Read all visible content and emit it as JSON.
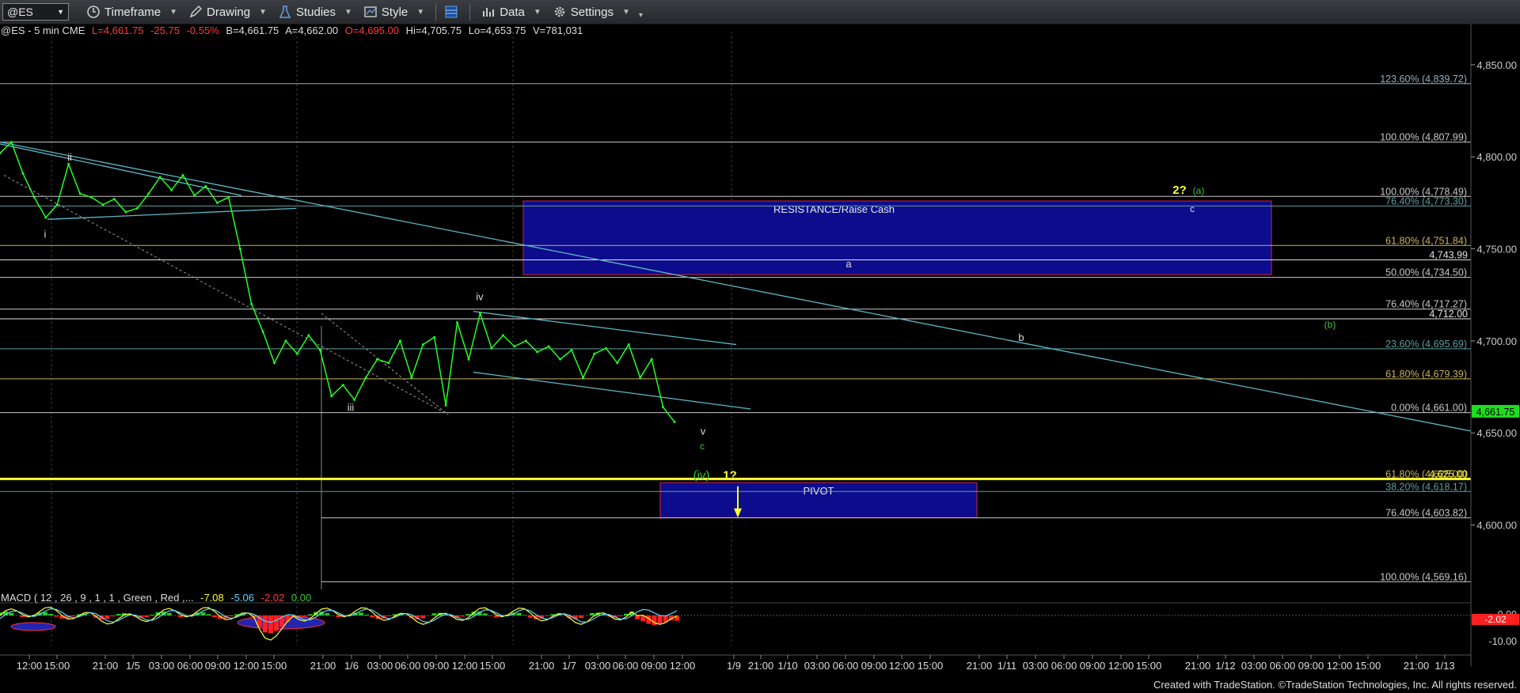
{
  "toolbar": {
    "symbol": "@ES",
    "items": [
      {
        "label": "Timeframe",
        "icon": "clock-icon"
      },
      {
        "label": "Drawing",
        "icon": "pen-icon"
      },
      {
        "label": "Studies",
        "icon": "flask-icon"
      },
      {
        "label": "Style",
        "icon": "chart-style-icon"
      },
      {
        "label": "",
        "icon": "layout-icon"
      },
      {
        "label": "Data",
        "icon": "bar-chart-icon"
      },
      {
        "label": "Settings",
        "icon": "gear-icon"
      }
    ]
  },
  "status": {
    "symbol": "@ES - 5 min  CME",
    "last": "L=4,661.75",
    "change": "-25.75",
    "pct": "-0.55%",
    "bid": "B=4,661.75",
    "ask": "A=4,662.00",
    "open": "O=4,695.00",
    "hi": "Hi=4,705.75",
    "lo": "Lo=4,653.75",
    "vol": "V=781,031"
  },
  "macd": {
    "label": "MACD ( 12 , 26 , 9 , 1 , 1 , Green , Red ,...",
    "v1": "-7.08",
    "v2": "-5.06",
    "v3": "-2.02",
    "v4": "0.00",
    "axis": [
      "0.00",
      "-10.00"
    ],
    "current": "-2.02"
  },
  "chart_data": {
    "type": "line",
    "title": "@ES - 5 min",
    "y_ticks": [
      4850,
      4800,
      4750,
      4700,
      4650,
      4600
    ],
    "y_tick_labels": [
      "4,850.00",
      "4,800.00",
      "4,750.00",
      "4,700.00",
      "4,650.00",
      "4,600.00"
    ],
    "ylim": [
      4565,
      4868
    ],
    "last_price_label": "4,661.75",
    "x_tick_labels": [
      "12:00",
      "15:00",
      "21:00",
      "1/5",
      "03:00",
      "06:00",
      "09:00",
      "12:00",
      "15:00",
      "21:00",
      "1/6",
      "03:00",
      "06:00",
      "09:00",
      "12:00",
      "15:00",
      "21:00",
      "1/7",
      "03:00",
      "06:00",
      "09:00",
      "12:00",
      "1/9",
      "21:00",
      "1/10",
      "03:00",
      "06:00",
      "09:00",
      "12:00",
      "15:00",
      "21:00",
      "1/11",
      "03:00",
      "06:00",
      "09:00",
      "12:00",
      "15:00",
      "21:00",
      "1/12",
      "03:00",
      "06:00",
      "09:00",
      "12:00",
      "15:00",
      "21:00",
      "1/13"
    ],
    "price_series": [
      [
        0,
        4802
      ],
      [
        1,
        4808
      ],
      [
        2,
        4791
      ],
      [
        3,
        4778
      ],
      [
        4,
        4767
      ],
      [
        5,
        4774
      ],
      [
        6,
        4796
      ],
      [
        7,
        4780
      ],
      [
        8,
        4778
      ],
      [
        9,
        4774
      ],
      [
        10,
        4777
      ],
      [
        11,
        4770
      ],
      [
        12,
        4772
      ],
      [
        13,
        4780
      ],
      [
        14,
        4789
      ],
      [
        15,
        4782
      ],
      [
        16,
        4790
      ],
      [
        17,
        4779
      ],
      [
        18,
        4784
      ],
      [
        19,
        4775
      ],
      [
        20,
        4778
      ],
      [
        21,
        4750
      ],
      [
        22,
        4720
      ],
      [
        23,
        4705
      ],
      [
        24,
        4688
      ],
      [
        25,
        4700
      ],
      [
        26,
        4693
      ],
      [
        27,
        4703
      ],
      [
        28,
        4695
      ],
      [
        29,
        4670
      ],
      [
        30,
        4676
      ],
      [
        31,
        4668
      ],
      [
        32,
        4680
      ],
      [
        33,
        4690
      ],
      [
        34,
        4688
      ],
      [
        35,
        4700
      ],
      [
        36,
        4680
      ],
      [
        37,
        4698
      ],
      [
        38,
        4702
      ],
      [
        39,
        4665
      ],
      [
        40,
        4710
      ],
      [
        41,
        4690
      ],
      [
        42,
        4715
      ],
      [
        43,
        4696
      ],
      [
        44,
        4703
      ],
      [
        45,
        4697
      ],
      [
        46,
        4700
      ],
      [
        47,
        4694
      ],
      [
        48,
        4697
      ],
      [
        49,
        4690
      ],
      [
        50,
        4695
      ],
      [
        51,
        4680
      ],
      [
        52,
        4693
      ],
      [
        53,
        4696
      ],
      [
        54,
        4688
      ],
      [
        55,
        4698
      ],
      [
        56,
        4680
      ],
      [
        57,
        4690
      ],
      [
        58,
        4664
      ],
      [
        59,
        4656
      ]
    ],
    "levels": [
      {
        "label": "123.60% (4,839.72)",
        "value": 4839.72,
        "color": "#9aaec0"
      },
      {
        "label": "100.00% (4,807.99)",
        "value": 4807.99,
        "color": "#c8c8c8"
      },
      {
        "label": "100.00% (4,778.49)",
        "value": 4778.49,
        "color": "#c8c8c8"
      },
      {
        "label": "76.40% (4,773.30)",
        "value": 4773.3,
        "color": "#5f9ea0"
      },
      {
        "label": "61.80% (4,751.84)",
        "value": 4751.84,
        "color": "#c9b45a"
      },
      {
        "label": "4,743.99",
        "value": 4743.99,
        "color": "#e0e0e0"
      },
      {
        "label": "50.00% (4,734.50)",
        "value": 4734.5,
        "color": "#c8c8c8"
      },
      {
        "label": "76.40% (4,717.27)",
        "value": 4717.27,
        "color": "#c8c8c8"
      },
      {
        "label": "4,712.00",
        "value": 4712.0,
        "color": "#e0e0e0"
      },
      {
        "label": "23.60% (4,695.69)",
        "value": 4695.69,
        "color": "#5f9ea0"
      },
      {
        "label": "61.80% (4,679.39)",
        "value": 4679.39,
        "color": "#c9b45a"
      },
      {
        "label": "0.00% (4,661.00)",
        "value": 4661.0,
        "color": "#c8c8c8"
      },
      {
        "label": "61.80% (4,625.00)",
        "value": 4625.0,
        "color": "#c9b45a"
      },
      {
        "label": "4,625.00",
        "value": 4625.0,
        "color": "#ffff33"
      },
      {
        "label": "38.20% (4,618.17)",
        "value": 4618.17,
        "color": "#5f9ea0"
      },
      {
        "label": "76.40% (4,603.82)",
        "value": 4603.82,
        "color": "#c8c8c8"
      },
      {
        "label": "100.00% (4,569.16)",
        "value": 4569.16,
        "color": "#c8c8c8"
      }
    ],
    "zones": [
      {
        "label": "RESISTANCE/Raise Cash",
        "top": 4776,
        "bottom": 4736
      },
      {
        "label": "PIVOT",
        "top": 4623,
        "bottom": 4604
      }
    ],
    "wave_labels": [
      {
        "text": "ii",
        "color": "#dddddd"
      },
      {
        "text": "i",
        "color": "#dddddd"
      },
      {
        "text": "iii",
        "color": "#dddddd"
      },
      {
        "text": "iv",
        "color": "#dddddd"
      },
      {
        "text": "v",
        "color": "#dddddd"
      },
      {
        "text": "c",
        "color": "#3cc33c"
      },
      {
        "text": "(iv)",
        "color": "#3cc33c"
      },
      {
        "text": "1?",
        "color": "#ffff33"
      },
      {
        "text": "2?",
        "color": "#ffff33"
      },
      {
        "text": "(a)",
        "color": "#3cc33c"
      },
      {
        "text": "c",
        "color": "#dddddd"
      },
      {
        "text": "a",
        "color": "#dddddd"
      },
      {
        "text": "b",
        "color": "#dddddd"
      },
      {
        "text": "(b)",
        "color": "#3cc33c"
      }
    ]
  },
  "footer": "Created with TradeStation. ©TradeStation Technologies, Inc. All rights reserved."
}
